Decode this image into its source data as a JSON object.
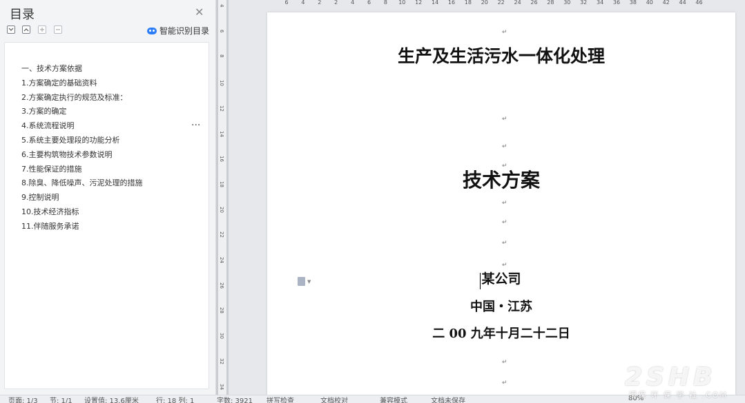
{
  "toc_panel": {
    "title": "目录",
    "smart_toc_label": "智能识别目录",
    "items": [
      "一、技术方案依据",
      "1.方案确定的基础资料",
      "2.方案确定执行的规范及标准：",
      "3.方案的确定",
      "4.系统流程说明",
      "5.系统主要处理段的功能分析",
      "6.主要构筑物技术参数说明",
      "7.性能保证的措施",
      "8.除臭、降低噪声、污泥处理的措施",
      "9.控制说明",
      "10.技术经济指标",
      "11.伴随服务承诺"
    ],
    "more_label": "···"
  },
  "rulers": {
    "horizontal_ticks": [
      "6",
      "4",
      "2",
      "2",
      "4",
      "6",
      "8",
      "10",
      "12",
      "14",
      "16",
      "18",
      "20",
      "22",
      "24",
      "26",
      "28",
      "30",
      "32",
      "34",
      "36",
      "38",
      "40",
      "42",
      "44",
      "46"
    ],
    "vertical_ticks": [
      "4",
      "6",
      "8",
      "10",
      "12",
      "14",
      "16",
      "18",
      "20",
      "22",
      "24",
      "26",
      "28",
      "30",
      "32",
      "34"
    ]
  },
  "document": {
    "title": "生产及生活污水一体化处理",
    "subtitle": "技术方案",
    "company": "某公司",
    "location": "中国・江苏",
    "date": "二 00 九年十月二十二日",
    "paragraph_mark": "↵"
  },
  "statusbar": {
    "page": "页面: 1/3",
    "section": "节: 1/1",
    "position": "设置值: 13.6厘米",
    "line_col": "行: 18  列: 1",
    "words": "字数: 3921",
    "spell": "拼写检查",
    "doc_check": "文档校对",
    "compat": "兼容模式",
    "doc_cloud": "文档未保存",
    "zoom": "80%"
  },
  "watermark": {
    "big": "2SHB",
    "small": "環保 环 保 学 社 .COM"
  }
}
